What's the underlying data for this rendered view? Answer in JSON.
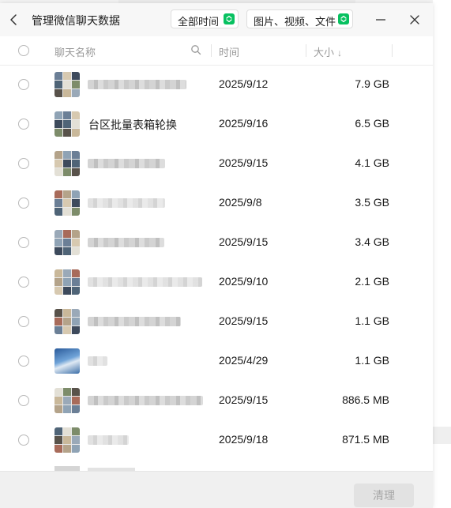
{
  "window": {
    "title": "管理微信聊天数据",
    "filters": {
      "time": "全部时间",
      "type": "图片、视频、文件"
    }
  },
  "columns": {
    "name": "聊天名称",
    "time": "时间",
    "size": "大小",
    "size_sort": "↓"
  },
  "colors": {
    "accent": "#07c160",
    "text": "#1a1a1a",
    "muted": "#9a9a9a",
    "disabled_text": "#a7a7a7"
  },
  "icons": {
    "back": "chevron-left-icon",
    "dropdown": "chevron-updown-icon",
    "minimize": "minus-icon",
    "close": "close-icon",
    "search": "search-icon",
    "sort": "arrow-down-icon"
  },
  "rows": [
    {
      "name": "",
      "redacted": true,
      "time": "2025/9/12",
      "size": "7.9 GB"
    },
    {
      "name": "台区批量表箱轮换",
      "redacted": false,
      "time": "2025/9/16",
      "size": "6.5 GB"
    },
    {
      "name": "",
      "redacted": true,
      "time": "2025/9/15",
      "size": "4.1 GB"
    },
    {
      "name": "",
      "redacted": true,
      "time": "2025/9/8",
      "size": "3.5 GB"
    },
    {
      "name": "",
      "redacted": true,
      "time": "2025/9/15",
      "size": "3.4 GB"
    },
    {
      "name": "",
      "redacted": true,
      "time": "2025/9/10",
      "size": "2.1 GB"
    },
    {
      "name": "",
      "redacted": true,
      "time": "2025/9/15",
      "size": "1.1 GB"
    },
    {
      "name": "",
      "redacted": true,
      "time": "2025/4/29",
      "size": "1.1 GB"
    },
    {
      "name": "",
      "redacted": true,
      "time": "2025/9/15",
      "size": "886.5 MB"
    },
    {
      "name": "",
      "redacted": true,
      "time": "2025/9/18",
      "size": "871.5 MB"
    }
  ],
  "footer": {
    "clean_label": "清理"
  }
}
